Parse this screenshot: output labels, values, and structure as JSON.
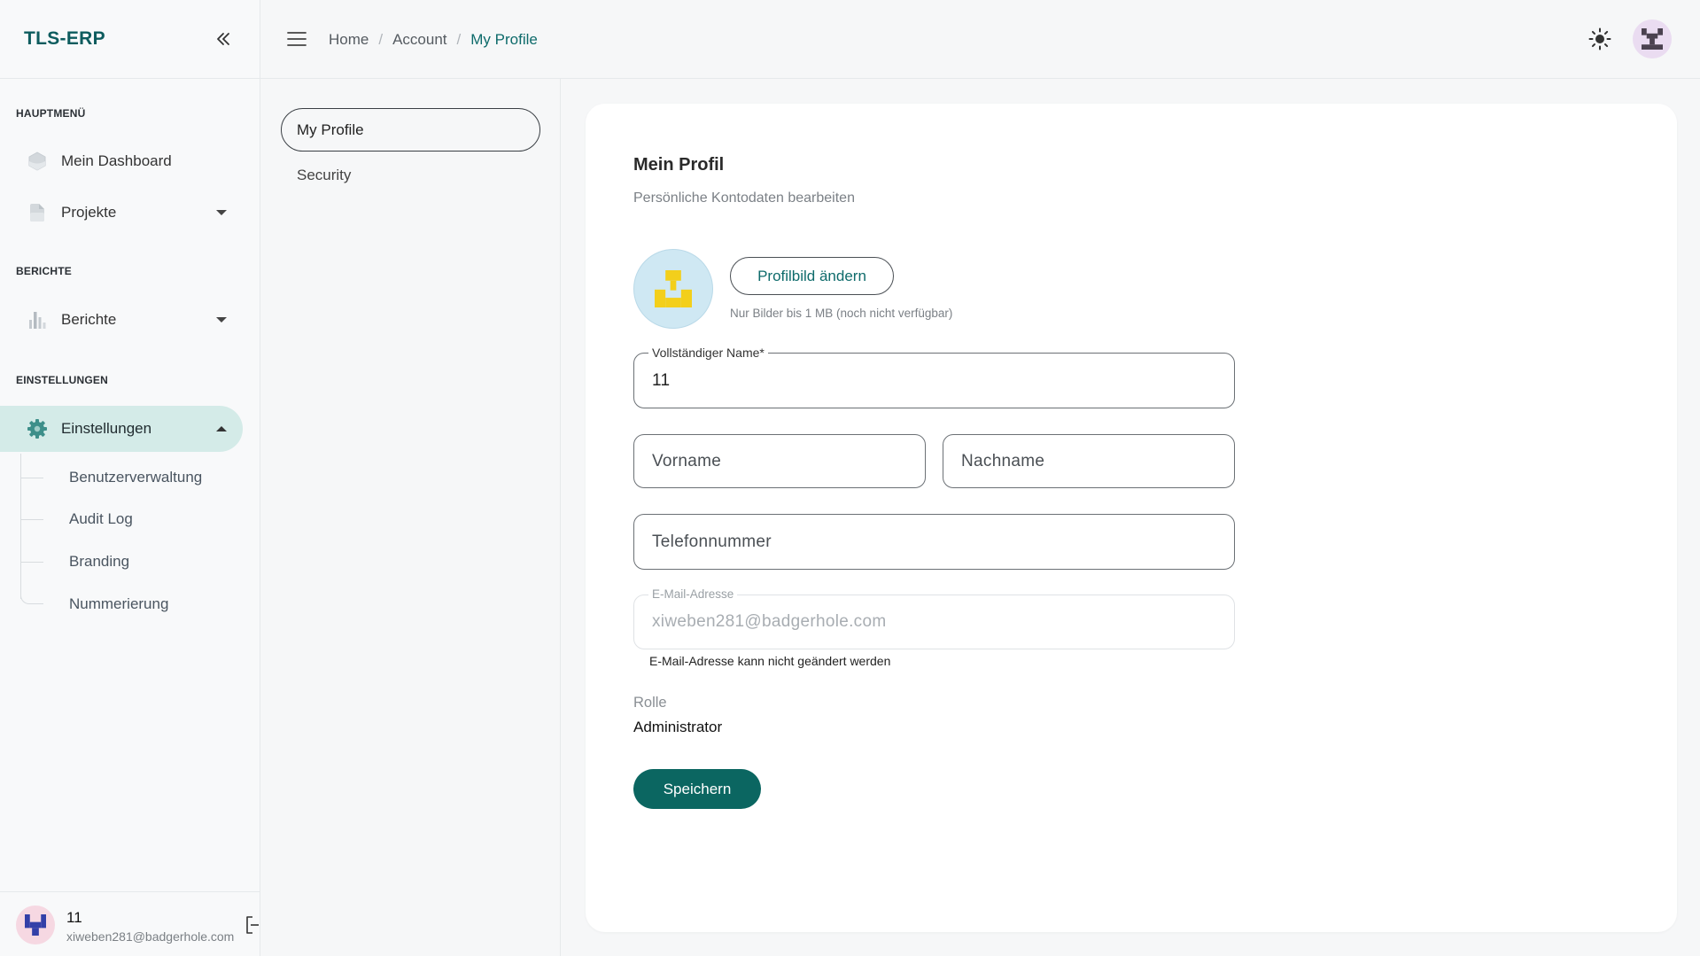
{
  "app": {
    "logo": "TLS-ERP"
  },
  "header": {
    "breadcrumb": [
      "Home",
      "Account",
      "My Profile"
    ],
    "separator": "/",
    "theme_icon": "sun-icon",
    "menu_icon": "hamburger-icon"
  },
  "sidebar": {
    "collapse_icon": "double-chevron-left-icon",
    "sections": [
      {
        "title": "HAUPTMENÜ",
        "items": [
          {
            "label": "Mein Dashboard",
            "icon": "dashboard-icon"
          },
          {
            "label": "Projekte",
            "icon": "folder-icon",
            "expandable": true
          }
        ]
      },
      {
        "title": "BERICHTE",
        "items": [
          {
            "label": "Berichte",
            "icon": "bar-chart-icon",
            "expandable": true
          }
        ]
      },
      {
        "title": "EINSTELLUNGEN",
        "items": [
          {
            "label": "Einstellungen",
            "icon": "gear-icon",
            "active": true,
            "expanded": true,
            "children": [
              "Benutzerverwaltung",
              "Audit Log",
              "Branding",
              "Nummerierung"
            ]
          }
        ]
      }
    ],
    "user": {
      "name": "11",
      "email": "xiweben281@badgerhole.com"
    }
  },
  "account_nav": {
    "items": [
      {
        "label": "My Profile",
        "active": true
      },
      {
        "label": "Security",
        "active": false
      }
    ]
  },
  "profile": {
    "title": "Mein Profil",
    "subtitle": "Persönliche Kontodaten bearbeiten",
    "change_avatar_label": "Profilbild ändern",
    "avatar_hint": "Nur Bilder bis 1 MB (noch nicht verfügbar)",
    "full_name": {
      "label": "Vollständiger Name*",
      "value": "11"
    },
    "first_name": {
      "placeholder": "Vorname",
      "value": ""
    },
    "last_name": {
      "placeholder": "Nachname",
      "value": ""
    },
    "phone": {
      "placeholder": "Telefonnummer",
      "value": ""
    },
    "email": {
      "label": "E-Mail-Adresse",
      "value": "xiweben281@badgerhole.com",
      "hint": "E-Mail-Adresse kann nicht geändert werden",
      "disabled": true
    },
    "role_label": "Rolle",
    "role_value": "Administrator",
    "save_label": "Speichern"
  },
  "colors": {
    "accent": "#0b6661",
    "accent_text": "#0e6b6b",
    "active_nav_bg": "#d4ebe8",
    "page_bg": "#f6f7f8",
    "card_bg": "#ffffff"
  }
}
